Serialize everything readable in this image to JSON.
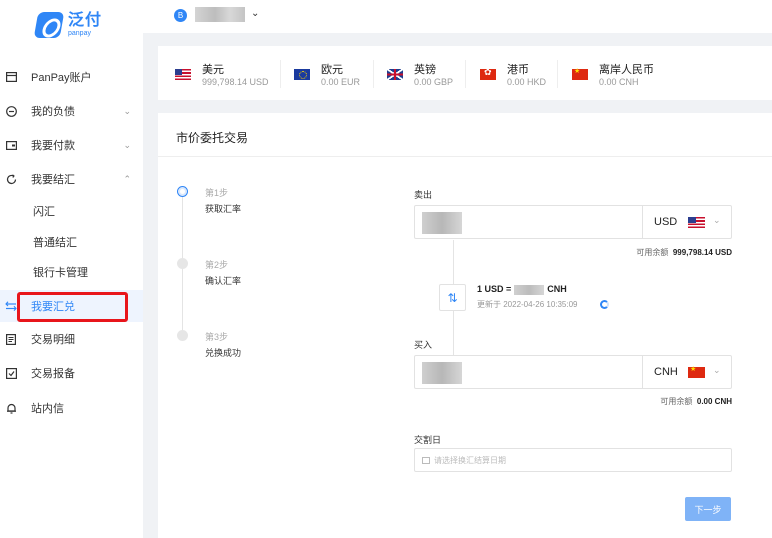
{
  "brand": {
    "name_cn": "泛付",
    "name_en": "panpay"
  },
  "header": {
    "account_icon_label": "B",
    "chevron": "⌄"
  },
  "sidebar": {
    "items": [
      {
        "label": "PanPay账户",
        "icon": "wallet-icon"
      },
      {
        "label": "我的负债",
        "icon": "minus-circle-icon",
        "chevron": "⌄"
      },
      {
        "label": "我要付款",
        "icon": "card-icon",
        "chevron": "⌄"
      },
      {
        "label": "我要结汇",
        "icon": "refresh-icon",
        "chevron": "⌃"
      },
      {
        "label": "闪汇",
        "sub": true
      },
      {
        "label": "普通结汇",
        "sub": true
      },
      {
        "label": "银行卡管理",
        "sub": true
      },
      {
        "label": "我要汇兑",
        "icon": "exchange-icon",
        "active": true
      },
      {
        "label": "交易明细",
        "icon": "list-icon"
      },
      {
        "label": "交易报备",
        "icon": "checkbox-icon"
      },
      {
        "label": "站内信",
        "icon": "bell-icon"
      }
    ]
  },
  "balances": [
    {
      "name": "美元",
      "amount": "999,798.14 USD",
      "flag": "us"
    },
    {
      "name": "欧元",
      "amount": "0.00 EUR",
      "flag": "eu"
    },
    {
      "name": "英镑",
      "amount": "0.00 GBP",
      "flag": "gb"
    },
    {
      "name": "港币",
      "amount": "0.00 HKD",
      "flag": "hk"
    },
    {
      "name": "离岸人民币",
      "amount": "0.00 CNH",
      "flag": "cn"
    }
  ],
  "trade": {
    "title": "市价委托交易",
    "steps": [
      {
        "no": "第1步",
        "name": "获取汇率",
        "active": true
      },
      {
        "no": "第2步",
        "name": "确认汇率",
        "active": false
      },
      {
        "no": "第3步",
        "name": "兑换成功",
        "active": false
      }
    ],
    "sell": {
      "label": "卖出",
      "currency": "USD",
      "available_label": "可用余额",
      "available_value": "999,798.14 USD"
    },
    "rate": {
      "prefix": "1 USD =",
      "suffix": "CNH",
      "updated": "更新于 2022-04-26 10:35:09"
    },
    "buy": {
      "label": "买入",
      "currency": "CNH",
      "available_label": "可用余额",
      "available_value": "0.00 CNH"
    },
    "settle": {
      "label": "交割日",
      "placeholder": "请选择换汇结算日期"
    },
    "next_button": "下一步"
  }
}
